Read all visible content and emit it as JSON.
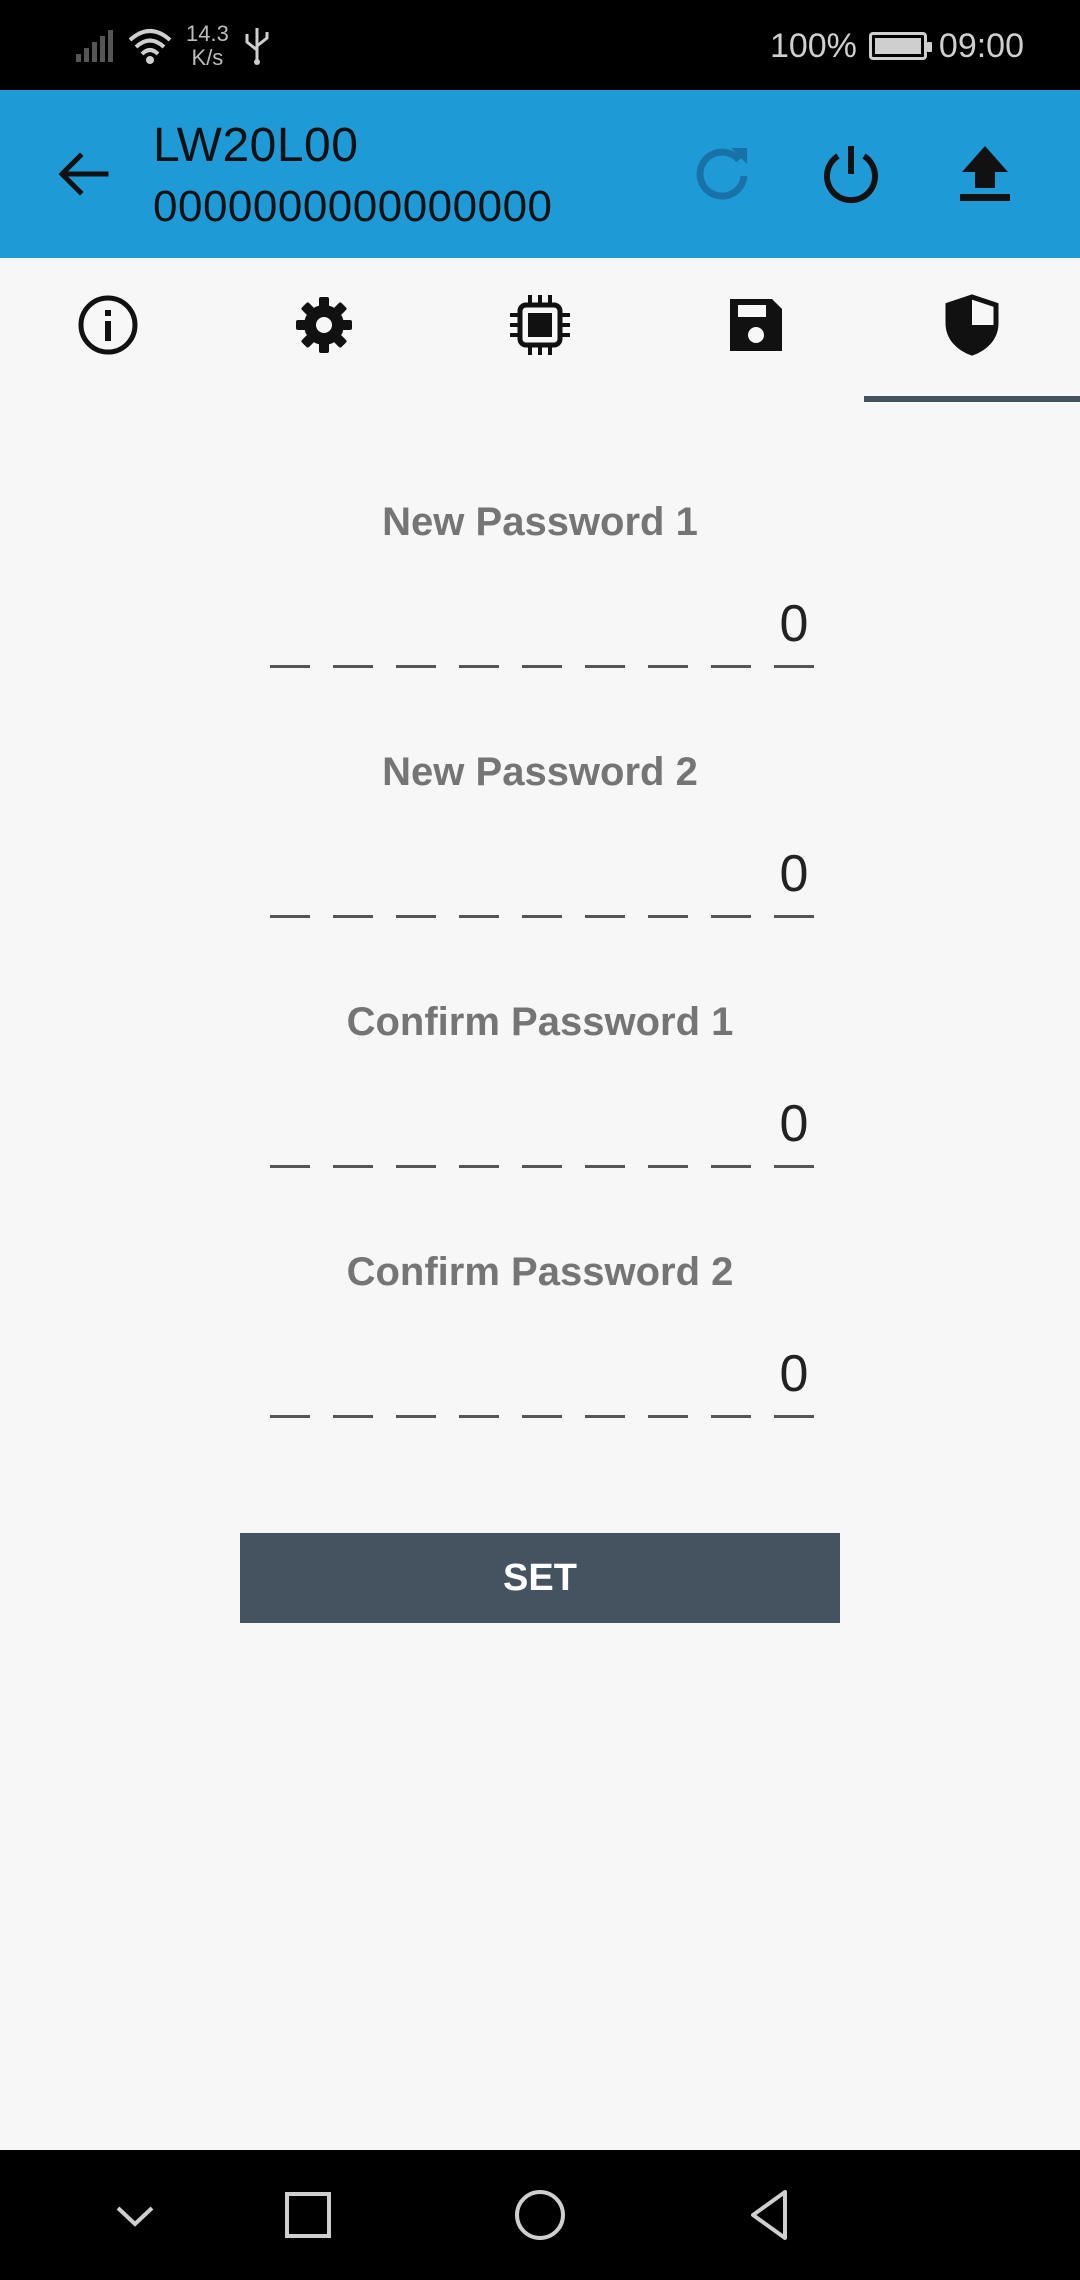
{
  "status_bar": {
    "network_speed_value": "14.3",
    "network_speed_unit": "K/s",
    "battery": "100%",
    "time": "09:00",
    "battery_level": 1.0,
    "icons": [
      "signal-icon",
      "wifi-icon",
      "usb-icon",
      "battery-icon"
    ]
  },
  "app_bar": {
    "title": "LW20L00",
    "subtitle": "0000000000000000",
    "background_color": "#1e9bd7",
    "actions": [
      "refresh-icon",
      "power-icon",
      "upload-icon"
    ]
  },
  "tabs": {
    "items": [
      "info-icon",
      "gear-icon",
      "chip-icon",
      "save-icon",
      "shield-icon"
    ],
    "selected_index": 4,
    "indicator_color": "#455260"
  },
  "form": {
    "fields": [
      {
        "label": "New Password 1",
        "digits": [
          "",
          "",
          "",
          "",
          "",
          "",
          "",
          "",
          "0"
        ]
      },
      {
        "label": "New Password 2",
        "digits": [
          "",
          "",
          "",
          "",
          "",
          "",
          "",
          "",
          "0"
        ]
      },
      {
        "label": "Confirm Password 1",
        "digits": [
          "",
          "",
          "",
          "",
          "",
          "",
          "",
          "",
          "0"
        ]
      },
      {
        "label": "Confirm Password 2",
        "digits": [
          "",
          "",
          "",
          "",
          "",
          "",
          "",
          "",
          "0"
        ]
      }
    ],
    "set_label": "SET",
    "button_color": "#455260"
  },
  "nav_bar": {
    "buttons": [
      "chevron-down-icon",
      "recents-icon",
      "home-icon",
      "back-triangle-icon"
    ]
  }
}
